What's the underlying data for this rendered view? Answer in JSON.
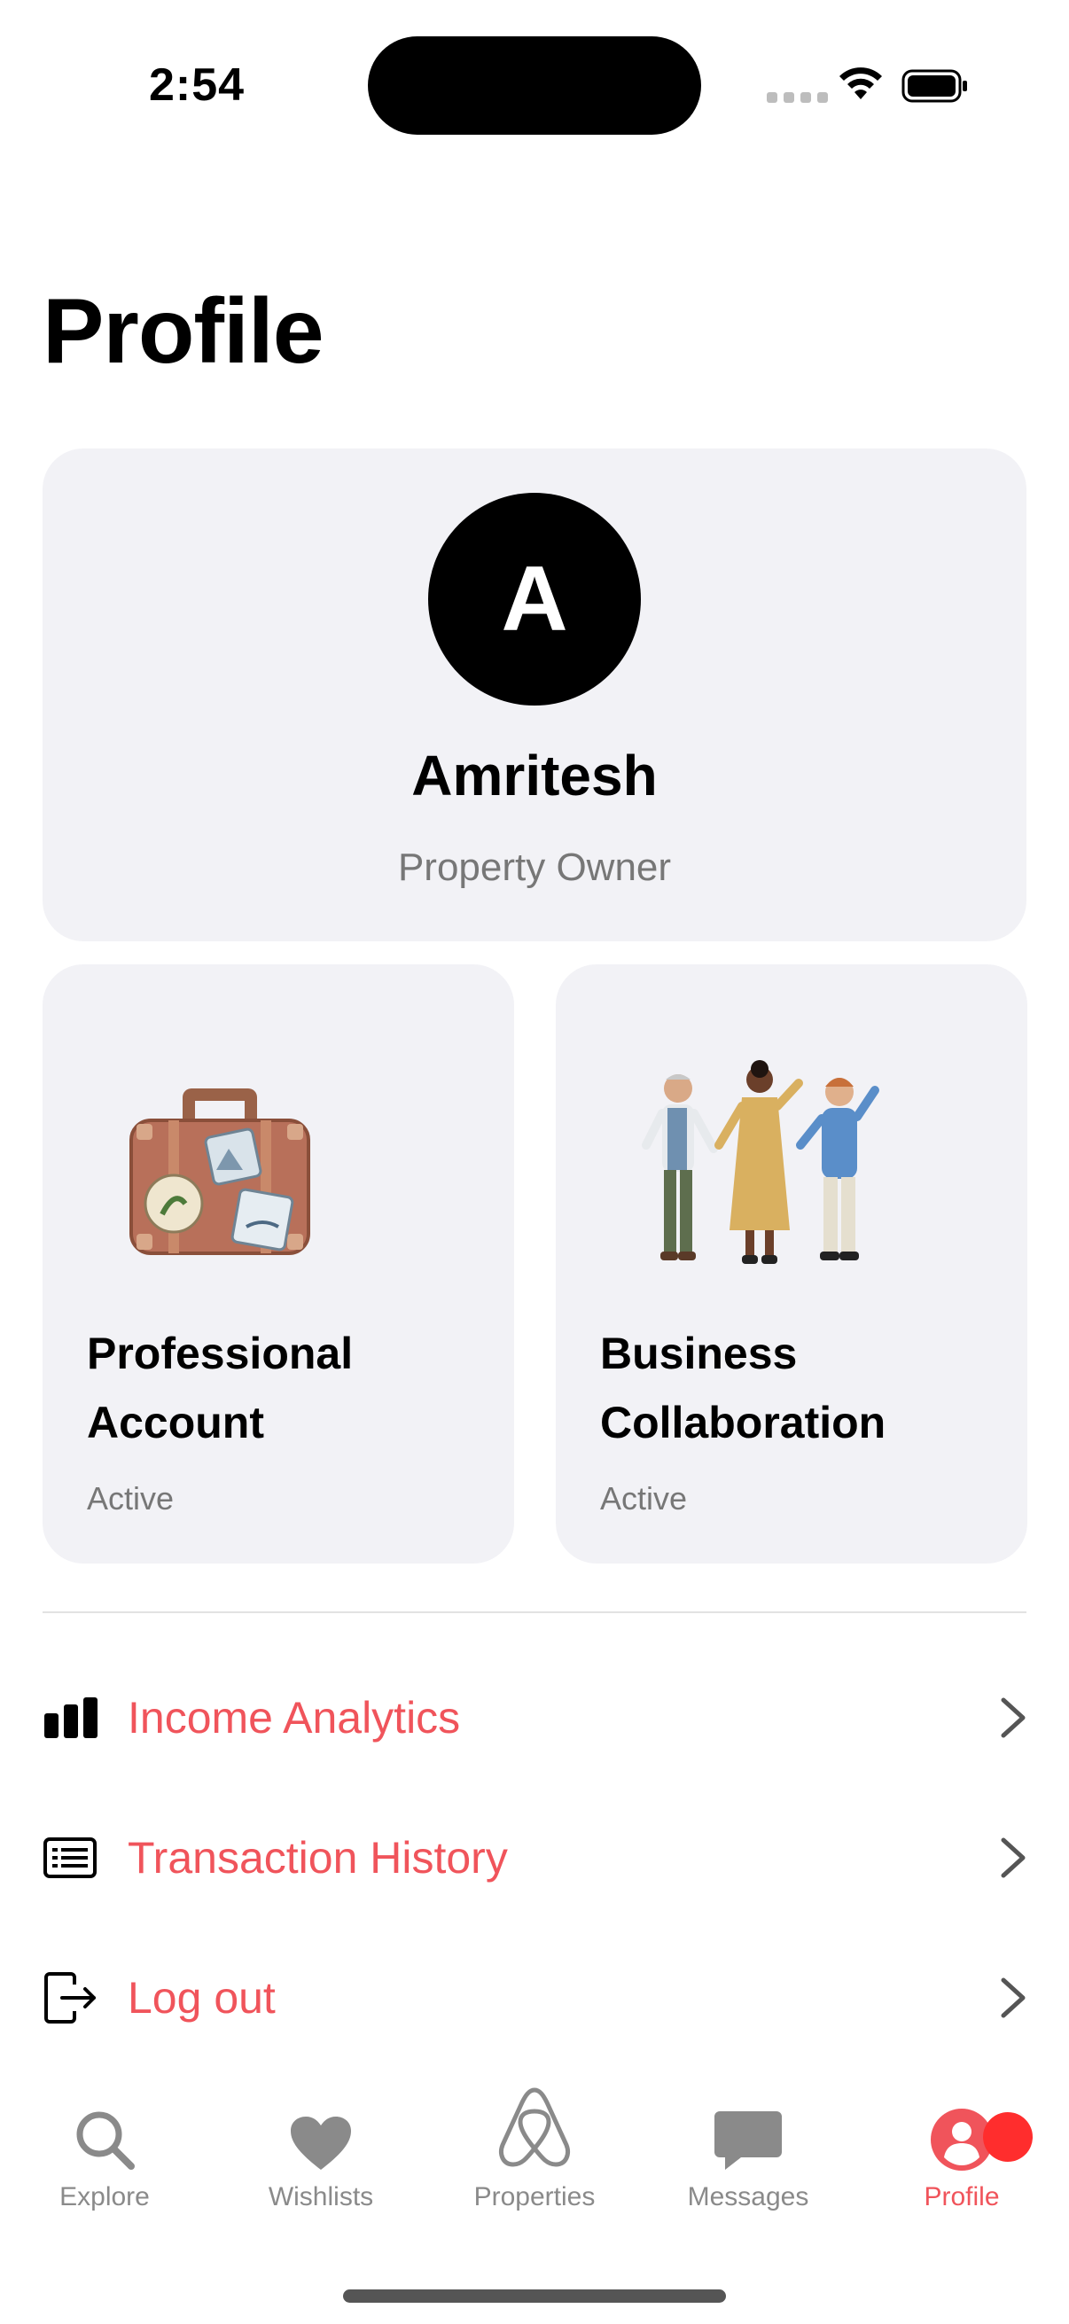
{
  "status_bar": {
    "time": "2:54"
  },
  "page_title": "Profile",
  "profile": {
    "avatar_initial": "A",
    "name": "Amritesh",
    "role": "Property Owner"
  },
  "cards": [
    {
      "title": "Professional Account",
      "status": "Active",
      "illustration": "suitcase-icon"
    },
    {
      "title": "Business Collaboration",
      "status": "Active",
      "illustration": "people-group-icon"
    }
  ],
  "menu": [
    {
      "label": "Income Analytics",
      "icon": "bar-chart-icon"
    },
    {
      "label": "Transaction History",
      "icon": "receipt-list-icon"
    },
    {
      "label": "Log out",
      "icon": "logout-icon"
    }
  ],
  "tabs": [
    {
      "label": "Explore",
      "icon": "search-icon",
      "active": false
    },
    {
      "label": "Wishlists",
      "icon": "heart-icon",
      "active": false
    },
    {
      "label": "Properties",
      "icon": "airbnb-logo-icon",
      "active": false
    },
    {
      "label": "Messages",
      "icon": "chat-bubble-icon",
      "active": false
    },
    {
      "label": "Profile",
      "icon": "person-circle-icon",
      "active": true
    }
  ],
  "colors": {
    "accent": "#f0545b",
    "card_background": "#f2f2f6",
    "secondary_text": "#777777",
    "tab_inactive": "#8a8a8a",
    "badge": "#ff2d2d"
  }
}
